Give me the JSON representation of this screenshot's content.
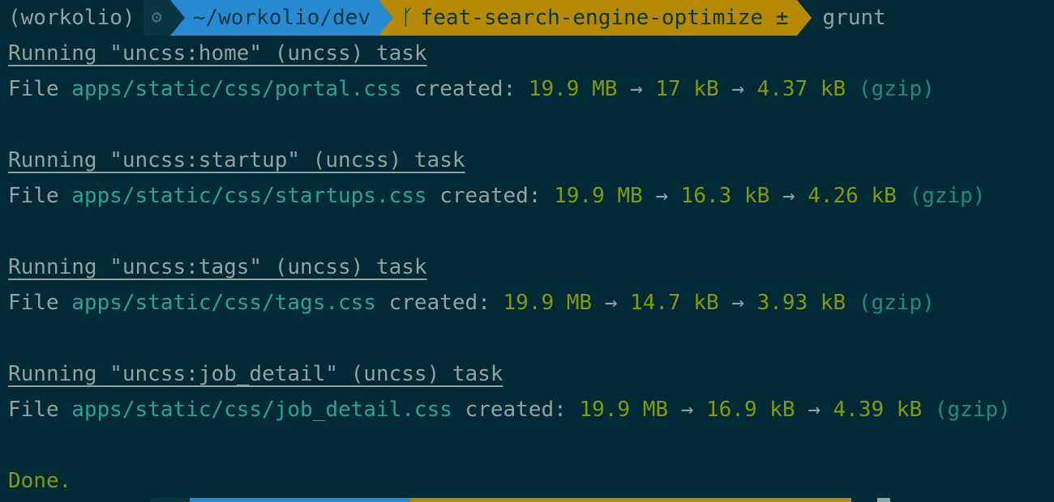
{
  "prompt": {
    "env": "(workolio)",
    "gear": "⚙",
    "path": "~/workolio/dev",
    "branch_icon": "ᚴ",
    "branch": "feat-search-engine-optimize ±",
    "command": "grunt"
  },
  "tasks": [
    {
      "running_label": "Running \"uncss:home\" (uncss) task",
      "file_prefix": "File",
      "file_path": "apps/static/css/portal.css",
      "created": "created:",
      "size_original": "19.9 MB",
      "arrow1": "→",
      "size_min": "17 kB",
      "arrow2": "→",
      "size_gzip": "4.37 kB",
      "gzip_label": "(gzip)"
    },
    {
      "running_label": "Running \"uncss:startup\" (uncss) task",
      "file_prefix": "File",
      "file_path": "apps/static/css/startups.css",
      "created": "created:",
      "size_original": "19.9 MB",
      "arrow1": "→",
      "size_min": "16.3 kB",
      "arrow2": "→",
      "size_gzip": "4.26 kB",
      "gzip_label": "(gzip)"
    },
    {
      "running_label": "Running \"uncss:tags\" (uncss) task",
      "file_prefix": "File",
      "file_path": "apps/static/css/tags.css",
      "created": "created:",
      "size_original": "19.9 MB",
      "arrow1": "→",
      "size_min": "14.7 kB",
      "arrow2": "→",
      "size_gzip": "3.93 kB",
      "gzip_label": "(gzip)"
    },
    {
      "running_label": "Running \"uncss:job_detail\" (uncss) task",
      "file_prefix": "File",
      "file_path": "apps/static/css/job_detail.css",
      "created": "created:",
      "size_original": "19.9 MB",
      "arrow1": "→",
      "size_min": "16.9 kB",
      "arrow2": "→",
      "size_gzip": "4.39 kB",
      "gzip_label": "(gzip)"
    }
  ],
  "done": "Done.",
  "colors": {
    "background": "#002b36",
    "path_segment": "#268bd2",
    "branch_segment": "#b58900",
    "file_path": "#2aa198",
    "numbers": "#859900"
  }
}
